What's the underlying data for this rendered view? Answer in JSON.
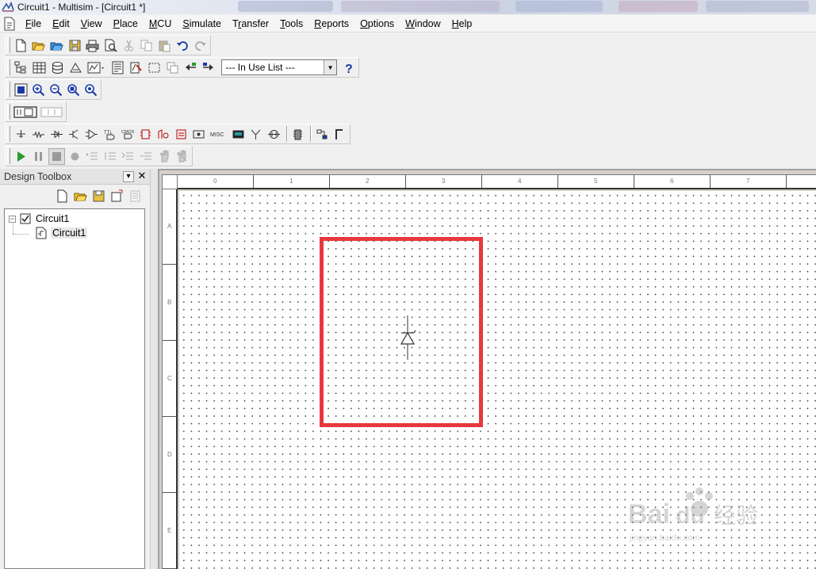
{
  "window": {
    "title": "Circuit1 - Multisim - [Circuit1 *]"
  },
  "menu": [
    {
      "pre": "",
      "u": "F",
      "post": "ile"
    },
    {
      "pre": "",
      "u": "E",
      "post": "dit"
    },
    {
      "pre": "",
      "u": "V",
      "post": "iew"
    },
    {
      "pre": "",
      "u": "P",
      "post": "lace"
    },
    {
      "pre": "",
      "u": "M",
      "post": "CU"
    },
    {
      "pre": "",
      "u": "S",
      "post": "imulate"
    },
    {
      "pre": "T",
      "u": "r",
      "post": "ansfer"
    },
    {
      "pre": "",
      "u": "T",
      "post": "ools"
    },
    {
      "pre": "",
      "u": "R",
      "post": "eports"
    },
    {
      "pre": "",
      "u": "O",
      "post": "ptions"
    },
    {
      "pre": "",
      "u": "W",
      "post": "indow"
    },
    {
      "pre": "",
      "u": "H",
      "post": "elp"
    }
  ],
  "in_use_list": {
    "value": "--- In Use List ---"
  },
  "toolbox": {
    "title": "Design Toolbox",
    "tree": {
      "root": "Circuit1",
      "child": "Circuit1"
    }
  },
  "ruler": {
    "top_labels": [
      "0",
      "1",
      "2",
      "3",
      "4",
      "5",
      "6",
      "7"
    ],
    "left_labels": [
      "A",
      "B",
      "C",
      "D",
      "E"
    ]
  },
  "toolbar_misc_label": "MISC",
  "colors": {
    "highlight": "#e8383d",
    "accent_blue": "#1a3aa8",
    "run_green": "#2a9a2a"
  }
}
